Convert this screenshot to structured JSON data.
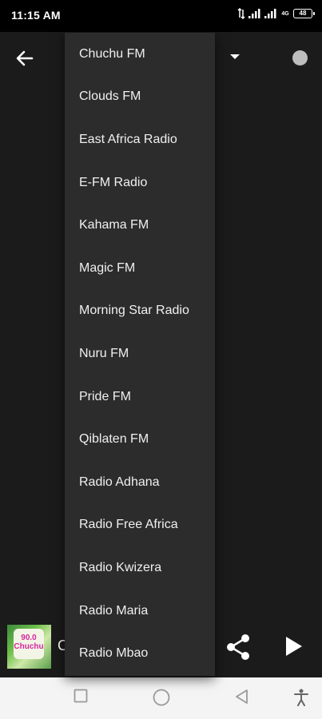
{
  "status_bar": {
    "time": "11:15 AM",
    "network_label": "4G",
    "battery_level": "48"
  },
  "toolbar": {
    "back_icon": "arrow-left-icon",
    "dropdown_icon": "caret-down-icon",
    "status_indicator_color": "#bdbdbd"
  },
  "dropdown": {
    "items": [
      {
        "label": "Chuchu FM"
      },
      {
        "label": "Clouds FM"
      },
      {
        "label": "East Africa Radio"
      },
      {
        "label": "E-FM Radio"
      },
      {
        "label": "Kahama FM"
      },
      {
        "label": "Magic FM"
      },
      {
        "label": "Morning Star Radio"
      },
      {
        "label": "Nuru FM"
      },
      {
        "label": "Pride FM"
      },
      {
        "label": "Qiblaten FM"
      },
      {
        "label": "Radio Adhana"
      },
      {
        "label": "Radio Free Africa"
      },
      {
        "label": "Radio Kwizera"
      },
      {
        "label": "Radio Maria"
      },
      {
        "label": "Radio Mbao"
      }
    ]
  },
  "player": {
    "station_logo_text": "90.0 Chuchu",
    "title_visible": "C",
    "share_icon": "share-icon",
    "play_icon": "play-icon"
  },
  "nav_bar": {
    "buttons": [
      "recents-icon",
      "home-icon",
      "back-triangle-icon",
      "accessibility-icon"
    ]
  }
}
